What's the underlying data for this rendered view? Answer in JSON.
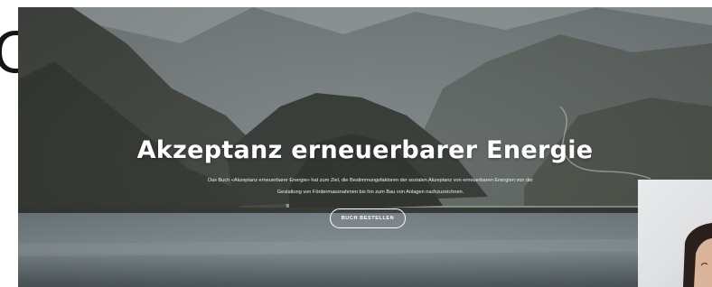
{
  "cut_off_letter": "C",
  "hero": {
    "title": "Akzeptanz erneuerbarer Energie",
    "description_line1": "Das Buch «Akzeptanz erneuerbarer Energie» hat zum Ziel, die Bestimmungsfaktoren der sozialen Akzeptanz von erneuerbaren Energien von der",
    "description_line2": "Gestaltung von Fördermassnahmen bis hin zum Bau von Anlagen nachzuzeichnen.",
    "button_label": "BUCH BESTELLEN"
  },
  "colors": {
    "hero_text": "#ffffff",
    "button_border": "#ffffff",
    "page_background": "#ffffff"
  },
  "icons": {
    "photo_overlay": "person-photo"
  }
}
